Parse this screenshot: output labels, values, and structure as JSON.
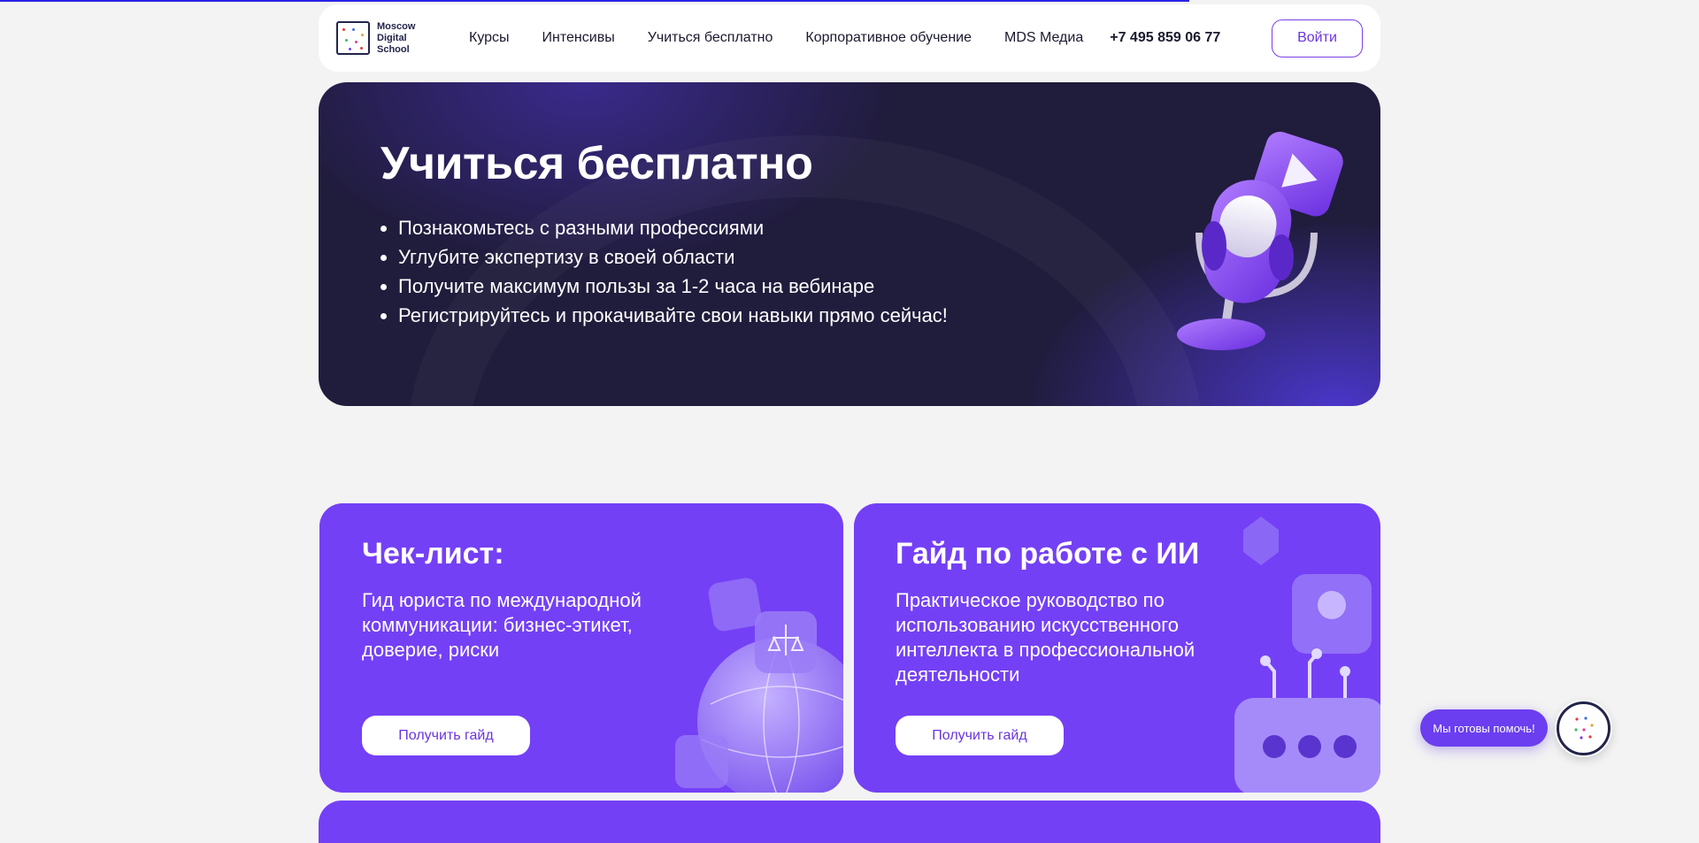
{
  "page": {
    "progress": 0.7,
    "accent": "#7440f5",
    "hero_bg": "#201c3c"
  },
  "header": {
    "logo": {
      "line1": "Moscow",
      "line2": "Digital",
      "line3": "School"
    },
    "nav": [
      "Курсы",
      "Интенсивы",
      "Учиться бесплатно",
      "Корпоративное обучение",
      "MDS Медиа"
    ],
    "phone": "+7 495 859 06 77",
    "login_label": "Войти"
  },
  "hero": {
    "title": "Учиться бесплатно",
    "bullets": [
      "Познакомьтесь с разными профессиями",
      "Углубите экспертизу в своей области",
      "Получите максимум пользы за 1-2 часа на вебинаре",
      "Регистрируйтесь и прокачивайте свои навыки прямо сейчас!"
    ],
    "icon": "microphone-play-icon"
  },
  "cards": [
    {
      "title": "Чек-лист:",
      "description": "Гид юриста по международной коммуникации: бизнес-этикет, доверие, риски",
      "button": "Получить гайд",
      "icon": "globe-law-icon"
    },
    {
      "title": "Гайд по работе с ИИ",
      "description": "Практическое руководство по использованию искусственного интеллекта в профессиональной деятельности",
      "button": "Получить гайд",
      "icon": "robot-icon"
    }
  ],
  "help": {
    "label": "Мы готовы помочь!",
    "avatar_icon": "mds-logo-icon"
  }
}
